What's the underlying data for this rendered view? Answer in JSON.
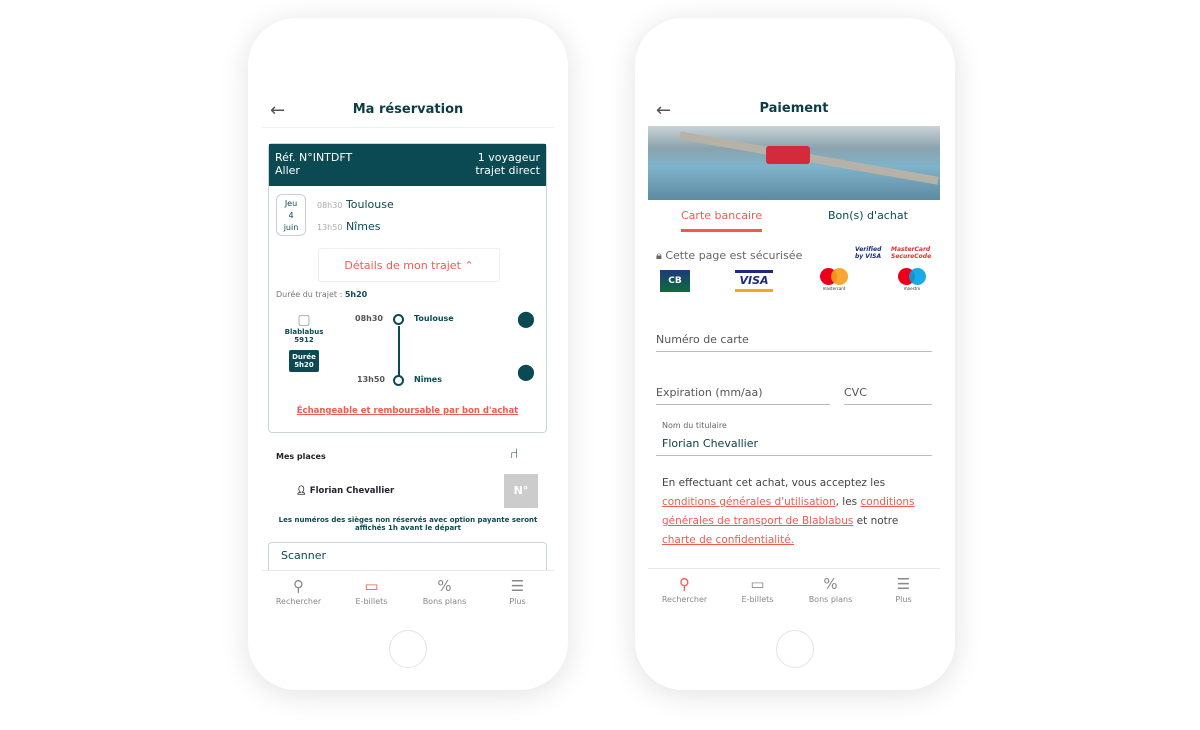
{
  "reservation": {
    "header": {
      "back_icon": "arrow-left-icon",
      "title": "Ma réservation"
    },
    "ref": "Réf. N°INTDFT",
    "direction": "Aller",
    "travelers": "1 voyageur",
    "trip_type": "trajet direct",
    "date": {
      "day": "Jeu",
      "num": "4",
      "month": "juin"
    },
    "dep_time": "08h30",
    "dep_city": "Toulouse",
    "arr_time": "13h50",
    "arr_city": "Nîmes",
    "details_button": "Détails de mon trajet",
    "duration_label": "Durée du trajet :",
    "duration": "5h20",
    "bus_name": "Blablabus",
    "bus_num": "5912",
    "badge_label": "Durée",
    "badge_value": "5h20",
    "refund_link": "Échangeable et remboursable par bon d'achat",
    "seats_title": "Mes places",
    "passenger": "Florian Chevallier",
    "seat": "N°",
    "seat_note": "Les numéros des sièges non réservés avec option payante seront affichés 1h avant le départ",
    "scanner": "Scanner"
  },
  "payment": {
    "header": {
      "back_icon": "arrow-left-icon",
      "title": "Paiement"
    },
    "tabs": [
      "Carte bancaire",
      "Bon(s) d'achat"
    ],
    "secure": "Cette page est sécurisée",
    "verified": "Verified by VISA",
    "securecode": "MasterCard SecureCode",
    "cards": [
      "CB",
      "VISA",
      "mastercard",
      "maestro"
    ],
    "card_number_placeholder": "Numéro de carte",
    "expiry_placeholder": "Expiration (mm/aa)",
    "cvc_placeholder": "CVC",
    "holder_label": "Nom du titulaire",
    "holder_value": "Florian Chevallier",
    "terms_1": "En effectuant cet achat, vous acceptez les ",
    "terms_link1": "conditions générales d'utilisation",
    "terms_2": ", les ",
    "terms_link2": "conditions générales de transport de Blablabus",
    "terms_3": " et notre ",
    "terms_link3": "charte de confidentialité."
  },
  "nav_left": [
    {
      "label": "Rechercher",
      "icon": "search-icon"
    },
    {
      "label": "E-billets",
      "icon": "ticket-icon",
      "active": true
    },
    {
      "label": "Bons plans",
      "icon": "percent-icon"
    },
    {
      "label": "Plus",
      "icon": "menu-icon"
    }
  ],
  "nav_right": [
    {
      "label": "Rechercher",
      "icon": "search-icon",
      "active": true
    },
    {
      "label": "E-billets",
      "icon": "ticket-icon"
    },
    {
      "label": "Bons plans",
      "icon": "percent-icon"
    },
    {
      "label": "Plus",
      "icon": "menu-icon"
    }
  ],
  "colors": {
    "primary": "#0b4a52",
    "accent": "#f25a4f"
  }
}
